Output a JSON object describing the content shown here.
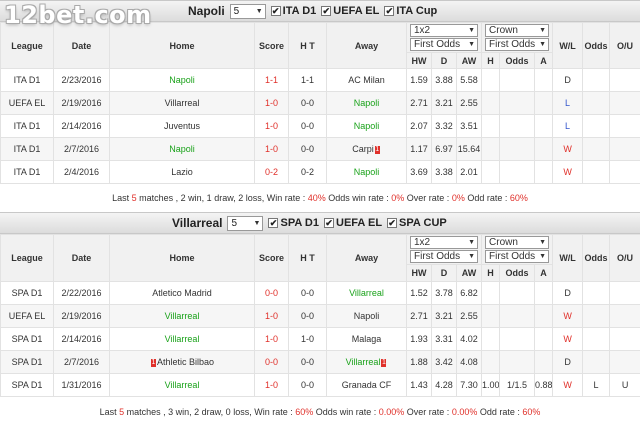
{
  "logo": "12bet.com",
  "sections": [
    {
      "team": "Napoli",
      "select_value": "5",
      "checkboxes": [
        "ITA D1",
        "UEFA EL",
        "ITA Cup"
      ],
      "headers": [
        "League",
        "Date",
        "Home",
        "Score",
        "H T",
        "Away"
      ],
      "odds_select": "1x2",
      "odds_type": "First Odds",
      "handicap_select": "Crown",
      "handicap_type": "First Odds",
      "right_headers": [
        "W/L",
        "Odds",
        "O/U"
      ],
      "sub_headers": [
        "HW",
        "D",
        "AW",
        "H",
        "Odds",
        "A"
      ],
      "rows": [
        {
          "league": "ITA D1",
          "date": "2/23/2016",
          "home": "Napoli",
          "score": "1-1",
          "ht": "1-1",
          "away": "AC Milan",
          "hw": "1.59",
          "d": "3.88",
          "aw": "5.58",
          "h": "",
          "odds": "",
          "a": "",
          "wl": "D",
          "odds2": "",
          "ou": "",
          "home_color": "green",
          "away_color": "plain",
          "score_color": "red",
          "wl_color": "plain",
          "home_card": "",
          "away_card": ""
        },
        {
          "league": "UEFA EL",
          "date": "2/19/2016",
          "home": "Villarreal",
          "score": "1-0",
          "ht": "0-0",
          "away": "Napoli",
          "hw": "2.71",
          "d": "3.21",
          "aw": "2.55",
          "h": "",
          "odds": "",
          "a": "",
          "wl": "L",
          "odds2": "",
          "ou": "",
          "home_color": "plain",
          "away_color": "green",
          "score_color": "red",
          "wl_color": "blue",
          "home_card": "",
          "away_card": ""
        },
        {
          "league": "ITA D1",
          "date": "2/14/2016",
          "home": "Juventus",
          "score": "1-0",
          "ht": "0-0",
          "away": "Napoli",
          "hw": "2.07",
          "d": "3.32",
          "aw": "3.51",
          "h": "",
          "odds": "",
          "a": "",
          "wl": "L",
          "odds2": "",
          "ou": "",
          "home_color": "plain",
          "away_color": "green",
          "score_color": "red",
          "wl_color": "blue",
          "home_card": "",
          "away_card": ""
        },
        {
          "league": "ITA D1",
          "date": "2/7/2016",
          "home": "Napoli",
          "score": "1-0",
          "ht": "0-0",
          "away": "Carpi",
          "hw": "1.17",
          "d": "6.97",
          "aw": "15.64",
          "h": "",
          "odds": "",
          "a": "",
          "wl": "W",
          "odds2": "",
          "ou": "",
          "home_color": "green",
          "away_color": "plain",
          "score_color": "red",
          "wl_color": "red",
          "home_card": "",
          "away_card": "1"
        },
        {
          "league": "ITA D1",
          "date": "2/4/2016",
          "home": "Lazio",
          "score": "0-2",
          "ht": "0-2",
          "away": "Napoli",
          "hw": "3.69",
          "d": "3.38",
          "aw": "2.01",
          "h": "",
          "odds": "",
          "a": "",
          "wl": "W",
          "odds2": "",
          "ou": "",
          "home_color": "plain",
          "away_color": "green",
          "score_color": "red",
          "wl_color": "red",
          "home_card": "",
          "away_card": ""
        }
      ],
      "summary": {
        "p1": "Last ",
        "matches": "5",
        "p2": " matches , 2 win, 1 draw, 2 loss, Win rate : ",
        "win_rate": "40%",
        "p3": " Odds win rate : ",
        "odds_win_rate": "0%",
        "p4": " Over rate : ",
        "over_rate": "0%",
        "p5": " Odd rate : ",
        "odd_rate": "60%"
      }
    },
    {
      "team": "Villarreal",
      "select_value": "5",
      "checkboxes": [
        "SPA D1",
        "UEFA EL",
        "SPA CUP"
      ],
      "headers": [
        "League",
        "Date",
        "Home",
        "Score",
        "H T",
        "Away"
      ],
      "odds_select": "1x2",
      "odds_type": "First Odds",
      "handicap_select": "Crown",
      "handicap_type": "First Odds",
      "right_headers": [
        "W/L",
        "Odds",
        "O/U"
      ],
      "sub_headers": [
        "HW",
        "D",
        "AW",
        "H",
        "Odds",
        "A"
      ],
      "rows": [
        {
          "league": "SPA D1",
          "date": "2/22/2016",
          "home": "Atletico Madrid",
          "score": "0-0",
          "ht": "0-0",
          "away": "Villarreal",
          "hw": "1.52",
          "d": "3.78",
          "aw": "6.82",
          "h": "",
          "odds": "",
          "a": "",
          "wl": "D",
          "odds2": "",
          "ou": "",
          "home_color": "plain",
          "away_color": "green",
          "score_color": "red",
          "wl_color": "plain",
          "home_card": "",
          "away_card": ""
        },
        {
          "league": "UEFA EL",
          "date": "2/19/2016",
          "home": "Villarreal",
          "score": "1-0",
          "ht": "0-0",
          "away": "Napoli",
          "hw": "2.71",
          "d": "3.21",
          "aw": "2.55",
          "h": "",
          "odds": "",
          "a": "",
          "wl": "W",
          "odds2": "",
          "ou": "",
          "home_color": "green",
          "away_color": "plain",
          "score_color": "red",
          "wl_color": "red",
          "home_card": "",
          "away_card": ""
        },
        {
          "league": "SPA D1",
          "date": "2/14/2016",
          "home": "Villarreal",
          "score": "1-0",
          "ht": "1-0",
          "away": "Malaga",
          "hw": "1.93",
          "d": "3.31",
          "aw": "4.02",
          "h": "",
          "odds": "",
          "a": "",
          "wl": "W",
          "odds2": "",
          "ou": "",
          "home_color": "green",
          "away_color": "plain",
          "score_color": "red",
          "wl_color": "red",
          "home_card": "",
          "away_card": ""
        },
        {
          "league": "SPA D1",
          "date": "2/7/2016",
          "home": "Athletic Bilbao",
          "score": "0-0",
          "ht": "0-0",
          "away": "Villarreal",
          "hw": "1.88",
          "d": "3.42",
          "aw": "4.08",
          "h": "",
          "odds": "",
          "a": "",
          "wl": "D",
          "odds2": "",
          "ou": "",
          "home_color": "plain",
          "away_color": "green",
          "score_color": "red",
          "wl_color": "plain",
          "home_card": "1",
          "away_card": "1"
        },
        {
          "league": "SPA D1",
          "date": "1/31/2016",
          "home": "Villarreal",
          "score": "1-0",
          "ht": "0-0",
          "away": "Granada CF",
          "hw": "1.43",
          "d": "4.28",
          "aw": "7.30",
          "h": "1.00",
          "odds": "1/1.5",
          "a": "0.88",
          "wl": "W",
          "odds2": "L",
          "ou": "U",
          "home_color": "green",
          "away_color": "plain",
          "score_color": "red",
          "wl_color": "red",
          "home_card": "",
          "away_card": ""
        }
      ],
      "summary": {
        "p1": "Last ",
        "matches": "5",
        "p2": " matches , 3 win, 2 draw, 0 loss, Win rate : ",
        "win_rate": "60%",
        "p3": " Odds win rate : ",
        "odds_win_rate": "0.00%",
        "p4": " Over rate : ",
        "over_rate": "0.00%",
        "p5": " Odd rate : ",
        "odd_rate": "60%"
      }
    }
  ]
}
